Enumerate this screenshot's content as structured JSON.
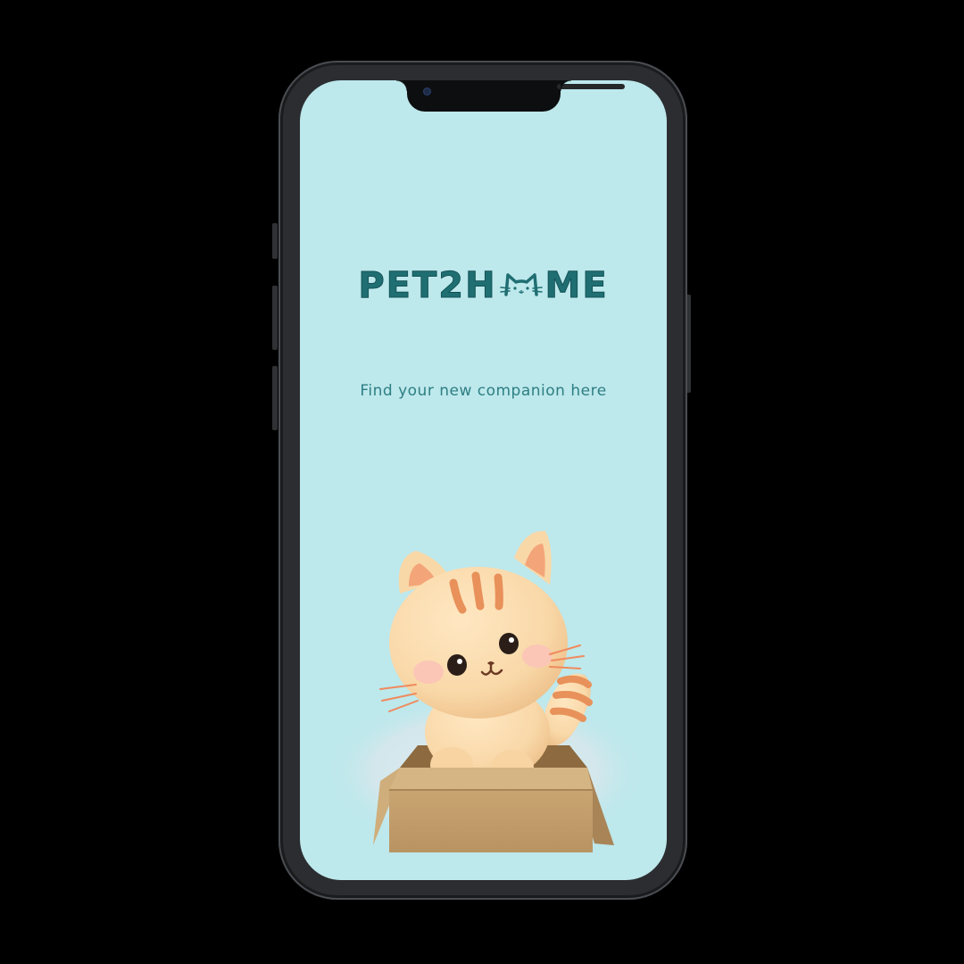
{
  "app": {
    "logo": {
      "text_before": "PET2H",
      "text_after": "ME",
      "accent_color": "#1f6e72"
    },
    "tagline": "Find your new companion here",
    "colors": {
      "screen_background": "#bde8ec",
      "text": "#2e7f83",
      "phone_frame": "#2b2d30"
    },
    "illustration": {
      "subject": "kitten-in-cardboard-box",
      "icon": "cat-face-icon"
    }
  }
}
